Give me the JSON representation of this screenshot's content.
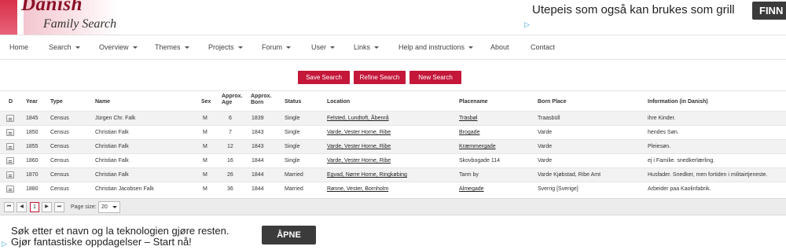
{
  "logo": {
    "line1": "Danish",
    "line2": "Family Search"
  },
  "ad_top": {
    "text": "Utepeis som også kan brukes som grill",
    "button": "FINN",
    "ad_icon": "ad-choices-icon"
  },
  "nav": {
    "items": [
      {
        "label": "Home",
        "caret": false
      },
      {
        "label": "Search",
        "caret": true
      },
      {
        "label": "Overview",
        "caret": true
      },
      {
        "label": "Themes",
        "caret": true
      },
      {
        "label": "Projects",
        "caret": true
      },
      {
        "label": "Forum",
        "caret": true
      },
      {
        "label": "User",
        "caret": true
      },
      {
        "label": "Links",
        "caret": true
      },
      {
        "label": "Help and instructions",
        "caret": true
      },
      {
        "label": "About",
        "caret": false
      },
      {
        "label": "Contact",
        "caret": false
      }
    ]
  },
  "actions": {
    "save": "Save Search",
    "refine": "Refine Search",
    "new": "New Search"
  },
  "table": {
    "headers": {
      "d": "D",
      "year": "Year",
      "type": "Type",
      "name": "Name",
      "sex": "Sex",
      "age": "Approx. Age",
      "born": "Approx. Born",
      "status": "Status",
      "location": "Location",
      "placename": "Placename",
      "birthplace": "Born Place",
      "info": "Information (in Danish)"
    },
    "rows": [
      {
        "year": "1845",
        "type": "Census",
        "name": "Jürgen Chr. Falk",
        "sex": "M",
        "age": "6",
        "born": "1839",
        "status": "Single",
        "location": "Felsted, Lundtoft, Åbenrå",
        "placename": "Träsbøl",
        "birthplace": "Traasbüll",
        "info": "ihre Kinder."
      },
      {
        "year": "1850",
        "type": "Census",
        "name": "Christian Falk",
        "sex": "M",
        "age": "7",
        "born": "1843",
        "status": "Single",
        "location": "Varde, Vester Horne, Ribe",
        "placename": "Brogade",
        "birthplace": "Varde",
        "info": "hendes Søn."
      },
      {
        "year": "1855",
        "type": "Census",
        "name": "Christian Falk",
        "sex": "M",
        "age": "12",
        "born": "1843",
        "status": "Single",
        "location": "Varde, Vester Horne, Ribe",
        "placename": "Kræmmergade",
        "birthplace": "Varde",
        "info": "Pleiesøn."
      },
      {
        "year": "1860",
        "type": "Census",
        "name": "Christian Falk",
        "sex": "M",
        "age": "16",
        "born": "1844",
        "status": "Single",
        "location": "Varde, Vester Horne, Ribe",
        "placename": "Skovbogade 114",
        "birthplace": "Varde",
        "info": "ej i Familie. snedkerlærling."
      },
      {
        "year": "1870",
        "type": "Census",
        "name": "Christian Falk",
        "sex": "M",
        "age": "26",
        "born": "1844",
        "status": "Married",
        "location": "Egvad, Nørre Horne, Ringkøbing",
        "placename": "Tarm by",
        "birthplace": "Varde Kjøbstad, Ribe Amt",
        "info": "Husfader. Snedker, men fortiden i militairtjeneste."
      },
      {
        "year": "1880",
        "type": "Census",
        "name": "Christian Jacobsen Falk",
        "sex": "M",
        "age": "36",
        "born": "1844",
        "status": "Married",
        "location": "Rønne, Vester, Bornholm",
        "placename": "Almegade",
        "birthplace": "Sverrig [Sverige]",
        "info": "Arbeider paa Kaolinfabrik."
      }
    ],
    "linked_placenames": [
      true,
      true,
      true,
      false,
      false,
      true
    ]
  },
  "pager": {
    "first": "⏮",
    "prev": "◀",
    "current": "1",
    "next": "▶",
    "last": "⏭",
    "size_label": "Page size:",
    "size_value": "20"
  },
  "ad_bottom": {
    "line1": "Søk etter et navn og la teknologien gjøre resten.",
    "line2": "Gjør fantastiske oppdagelser – Start nå!",
    "button": "ÅPNE",
    "ad_icon": "ad-choices-icon"
  },
  "colors": {
    "accent": "#c4173a",
    "alt_row": "#f2f2f2"
  }
}
